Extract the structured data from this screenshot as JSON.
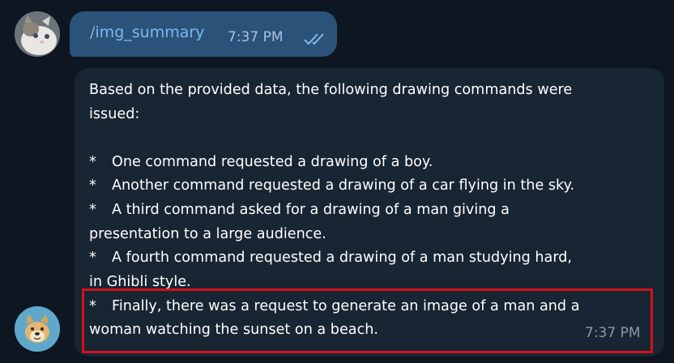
{
  "outgoing": {
    "command": "/img_summary",
    "time": "7:37 PM",
    "status_icon": "double-check-icon"
  },
  "incoming": {
    "intro_line1": "Based on the provided data, the following drawing commands were",
    "intro_line2": "issued:",
    "bullet": "*",
    "item1": "One command requested a drawing of a boy.",
    "item2": "Another command requested a drawing of a car flying in the sky.",
    "item3_line1": "A third command asked for a drawing of a man giving a",
    "item3_line2": "presentation to a large audience.",
    "item4_line1": "A fourth command requested a drawing of a man studying hard,",
    "item4_line2": "in Ghibli style.",
    "item5_line1": "Finally, there was a request to generate an image of a man and a",
    "item5_line2": "woman watching the sunset on a beach.",
    "time": "7:37 PM"
  },
  "colors": {
    "background": "#0e1621",
    "outgoing_bubble": "#2b5278",
    "incoming_bubble": "#182533",
    "command_link": "#7fb8f0",
    "highlight_border": "#d3111b"
  }
}
